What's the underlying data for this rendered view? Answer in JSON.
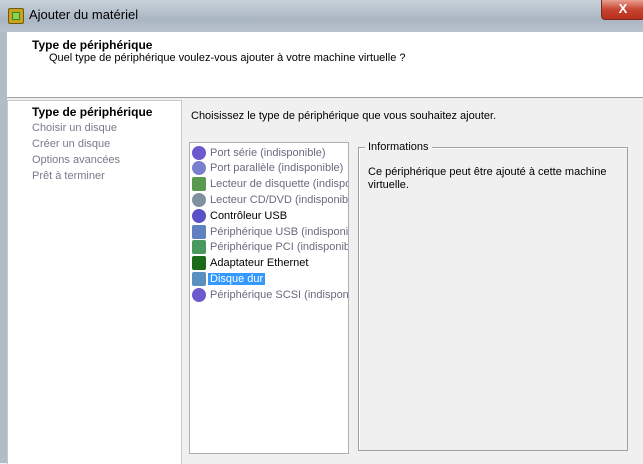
{
  "window": {
    "title": "Ajouter du matériel",
    "close_label": "X"
  },
  "header": {
    "title": "Type de périphérique",
    "subtitle": "Quel type de périphérique voulez-vous ajouter à votre machine virtuelle ?"
  },
  "sidebar": {
    "items": [
      {
        "label": "Type de périphérique",
        "active": true
      },
      {
        "label": "Choisir un disque"
      },
      {
        "label": "Créer un disque"
      },
      {
        "label": "Options avancées"
      },
      {
        "label": "Prêt à terminer"
      }
    ]
  },
  "main": {
    "prompt": "Choisissez le type de périphérique que vous souhaitez ajouter.",
    "devices": [
      {
        "label": "Port série (indisponible)",
        "icon": "serial-port-icon",
        "color": "#6a5acd"
      },
      {
        "label": "Port parallèle (indisponible)",
        "icon": "parallel-port-icon",
        "color": "#7b7fd0"
      },
      {
        "label": "Lecteur de disquette (indisponible)",
        "icon": "floppy-icon",
        "color": "#5a9a50"
      },
      {
        "label": "Lecteur CD/DVD (indisponible)",
        "icon": "cd-dvd-icon",
        "color": "#8090a0"
      },
      {
        "label": "Contrôleur USB",
        "icon": "usb-controller-icon",
        "color": "#5a50c8"
      },
      {
        "label": "Périphérique USB (indisponible)",
        "icon": "usb-device-icon",
        "color": "#6080c0"
      },
      {
        "label": "Périphérique PCI (indisponible)",
        "icon": "pci-card-icon",
        "color": "#4a9a60"
      },
      {
        "label": "Adaptateur Ethernet",
        "icon": "ethernet-adapter-icon",
        "color": "#1a6a1a"
      },
      {
        "label": "Disque dur",
        "icon": "hard-disk-icon",
        "color": "#5a90c0"
      },
      {
        "label": "Périphérique SCSI (indisponible)",
        "icon": "scsi-icon",
        "color": "#6a5acd"
      }
    ],
    "selected": "Disque dur",
    "info": {
      "legend": "Informations",
      "text": "Ce périphérique peut être ajouté à cette machine virtuelle."
    }
  }
}
